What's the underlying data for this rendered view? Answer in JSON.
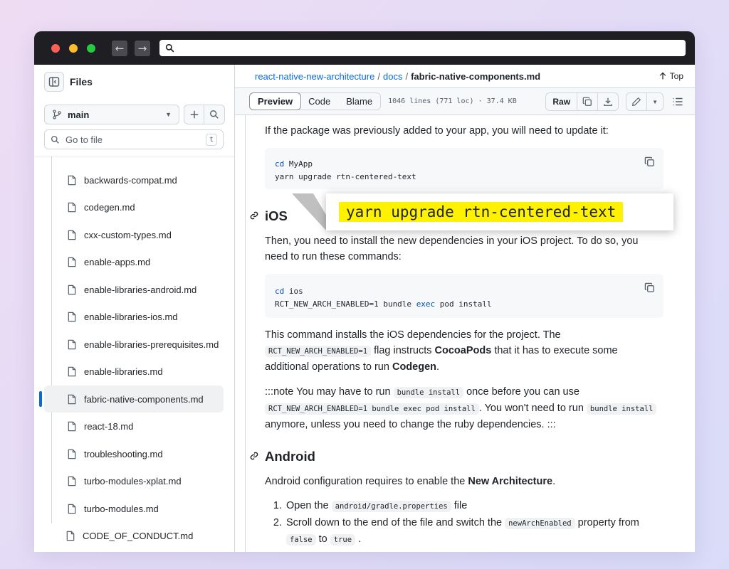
{
  "sidebar": {
    "title": "Files",
    "branch": "main",
    "goto_placeholder": "Go to file",
    "goto_shortcut": "t",
    "files": [
      "backwards-compat.md",
      "codegen.md",
      "cxx-custom-types.md",
      "enable-apps.md",
      "enable-libraries-android.md",
      "enable-libraries-ios.md",
      "enable-libraries-prerequisites.md",
      "enable-libraries.md",
      "fabric-native-components.md",
      "react-18.md",
      "troubleshooting.md",
      "turbo-modules-xplat.md",
      "turbo-modules.md"
    ],
    "root_file": "CODE_OF_CONDUCT.md",
    "active_file": "fabric-native-components.md"
  },
  "breadcrumb": {
    "repo": "react-native-new-architecture",
    "sep1": "/",
    "folder": "docs",
    "sep2": "/",
    "file": "fabric-native-components.md",
    "top_label": "Top"
  },
  "toolbar": {
    "tab_preview": "Preview",
    "tab_code": "Code",
    "tab_blame": "Blame",
    "meta": "1046 lines (771 loc) · 37.4 KB",
    "raw_label": "Raw"
  },
  "content": {
    "intro": "If the package was previously added to your app, you will need to update it:",
    "code1_kw": "cd",
    "code1_line1_rest": " MyApp",
    "code1_line2": "yarn upgrade rtn-centered-text",
    "zoom_text": "yarn upgrade rtn-centered-text",
    "ios_heading": "iOS",
    "ios_p1": "Then, you need to install the new dependencies in your iOS project. To do so, you need to run these commands:",
    "code2_kw": "cd",
    "code2_line1_rest": " ios",
    "code2_line2_a": "RCT_NEW_ARCH_ENABLED=1 bundle ",
    "code2_line2_kw": "exec",
    "code2_line2_b": " pod install",
    "ios_p2_a": "This command installs the iOS dependencies for the project. The ",
    "ios_p2_code": "RCT_NEW_ARCH_ENABLED=1",
    "ios_p2_b": " flag instructs ",
    "ios_p2_strong1": "CocoaPods",
    "ios_p2_c": " that it has to execute some additional operations to run ",
    "ios_p2_strong2": "Codegen",
    "ios_p2_d": ".",
    "note_a": ":::note You may have to run ",
    "note_code1": "bundle install",
    "note_b": " once before you can use ",
    "note_code2": "RCT_NEW_ARCH_ENABLED=1 bundle exec pod install",
    "note_c": ". You won't need to run ",
    "note_code3": "bundle install",
    "note_d": " anymore, unless you need to change the ruby dependencies. :::",
    "android_heading": "Android",
    "android_p_a": "Android configuration requires to enable the ",
    "android_p_strong": "New Architecture",
    "android_p_b": ".",
    "step1_a": "Open the ",
    "step1_code": "android/gradle.properties",
    "step1_b": " file",
    "step2_a": "Scroll down to the end of the file and switch the ",
    "step2_code1": "newArchEnabled",
    "step2_b": " property from ",
    "step2_code2": "false",
    "step2_c": " to ",
    "step2_code3": "true",
    "step2_d": " ."
  },
  "colors": {
    "link": "#0969da",
    "highlight": "#fff200",
    "active_bar": "#0969da"
  }
}
